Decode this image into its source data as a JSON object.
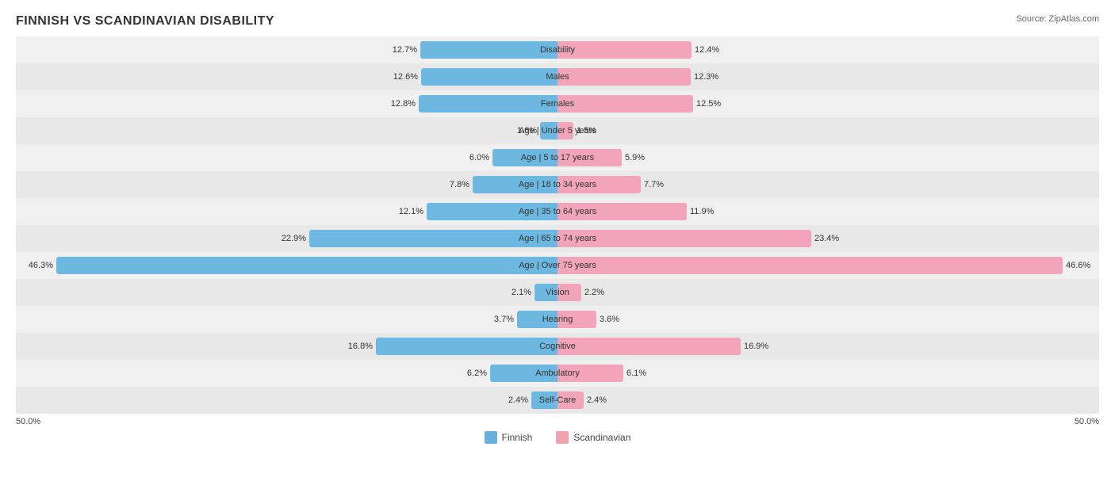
{
  "title": "FINNISH VS SCANDINAVIAN DISABILITY",
  "source": "Source: ZipAtlas.com",
  "axis": {
    "left": "50.0%",
    "right": "50.0%"
  },
  "colors": {
    "finnish": "#6db8e0",
    "scandinavian": "#f2a5b8"
  },
  "legend": {
    "finnish_label": "Finnish",
    "scandinavian_label": "Scandinavian"
  },
  "rows": [
    {
      "label": "Disability",
      "left_pct": 12.7,
      "right_pct": 12.4,
      "left_val": "12.7%",
      "right_val": "12.4%"
    },
    {
      "label": "Males",
      "left_pct": 12.6,
      "right_pct": 12.3,
      "left_val": "12.6%",
      "right_val": "12.3%"
    },
    {
      "label": "Females",
      "left_pct": 12.8,
      "right_pct": 12.5,
      "left_val": "12.8%",
      "right_val": "12.5%"
    },
    {
      "label": "Age | Under 5 years",
      "left_pct": 1.6,
      "right_pct": 1.5,
      "left_val": "1.6%",
      "right_val": "1.5%"
    },
    {
      "label": "Age | 5 to 17 years",
      "left_pct": 6.0,
      "right_pct": 5.9,
      "left_val": "6.0%",
      "right_val": "5.9%"
    },
    {
      "label": "Age | 18 to 34 years",
      "left_pct": 7.8,
      "right_pct": 7.7,
      "left_val": "7.8%",
      "right_val": "7.7%"
    },
    {
      "label": "Age | 35 to 64 years",
      "left_pct": 12.1,
      "right_pct": 11.9,
      "left_val": "12.1%",
      "right_val": "11.9%"
    },
    {
      "label": "Age | 65 to 74 years",
      "left_pct": 22.9,
      "right_pct": 23.4,
      "left_val": "22.9%",
      "right_val": "23.4%"
    },
    {
      "label": "Age | Over 75 years",
      "left_pct": 46.3,
      "right_pct": 46.6,
      "left_val": "46.3%",
      "right_val": "46.6%"
    },
    {
      "label": "Vision",
      "left_pct": 2.1,
      "right_pct": 2.2,
      "left_val": "2.1%",
      "right_val": "2.2%"
    },
    {
      "label": "Hearing",
      "left_pct": 3.7,
      "right_pct": 3.6,
      "left_val": "3.7%",
      "right_val": "3.6%"
    },
    {
      "label": "Cognitive",
      "left_pct": 16.8,
      "right_pct": 16.9,
      "left_val": "16.8%",
      "right_val": "16.9%"
    },
    {
      "label": "Ambulatory",
      "left_pct": 6.2,
      "right_pct": 6.1,
      "left_val": "6.2%",
      "right_val": "6.1%"
    },
    {
      "label": "Self-Care",
      "left_pct": 2.4,
      "right_pct": 2.4,
      "left_val": "2.4%",
      "right_val": "2.4%"
    }
  ],
  "max_pct": 50
}
